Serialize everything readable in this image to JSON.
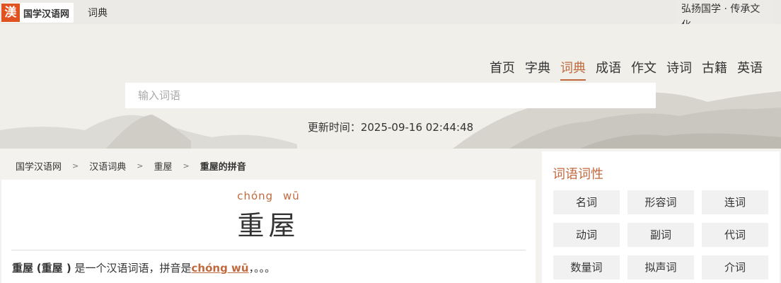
{
  "topbar": {
    "logo_mark": "渼",
    "site_name": "国学汉语网",
    "cidian_link": "词典",
    "slogan": "弘扬国学 · 传承文化"
  },
  "nav": [
    "首页",
    "字典",
    "词典",
    "成语",
    "作文",
    "诗词",
    "古籍",
    "英语"
  ],
  "nav_active_index": 2,
  "search": {
    "placeholder": "输入词语"
  },
  "update_text": "更新时间：2025-09-16 02:44:48",
  "breadcrumb": [
    "国学汉语网",
    "汉语词典",
    "重屋",
    "重屋的拼音"
  ],
  "breadcrumb_sep": ">",
  "word": {
    "pinyin": [
      "chóng",
      "wū"
    ],
    "text": "重屋",
    "desc_word": "重屋",
    "desc_trad": "(重屋 )",
    "desc_mid": "是一个汉语词语，拼音是",
    "desc_pinyin": "chóng wū",
    "desc_end": "，。。。"
  },
  "sidebar": {
    "title": "词语词性",
    "items": [
      "名词",
      "形容词",
      "连词",
      "动词",
      "副词",
      "代词",
      "数量词",
      "拟声词",
      "介词"
    ]
  },
  "colors": {
    "accent": "#c0693e",
    "logo": "#e0521f"
  }
}
